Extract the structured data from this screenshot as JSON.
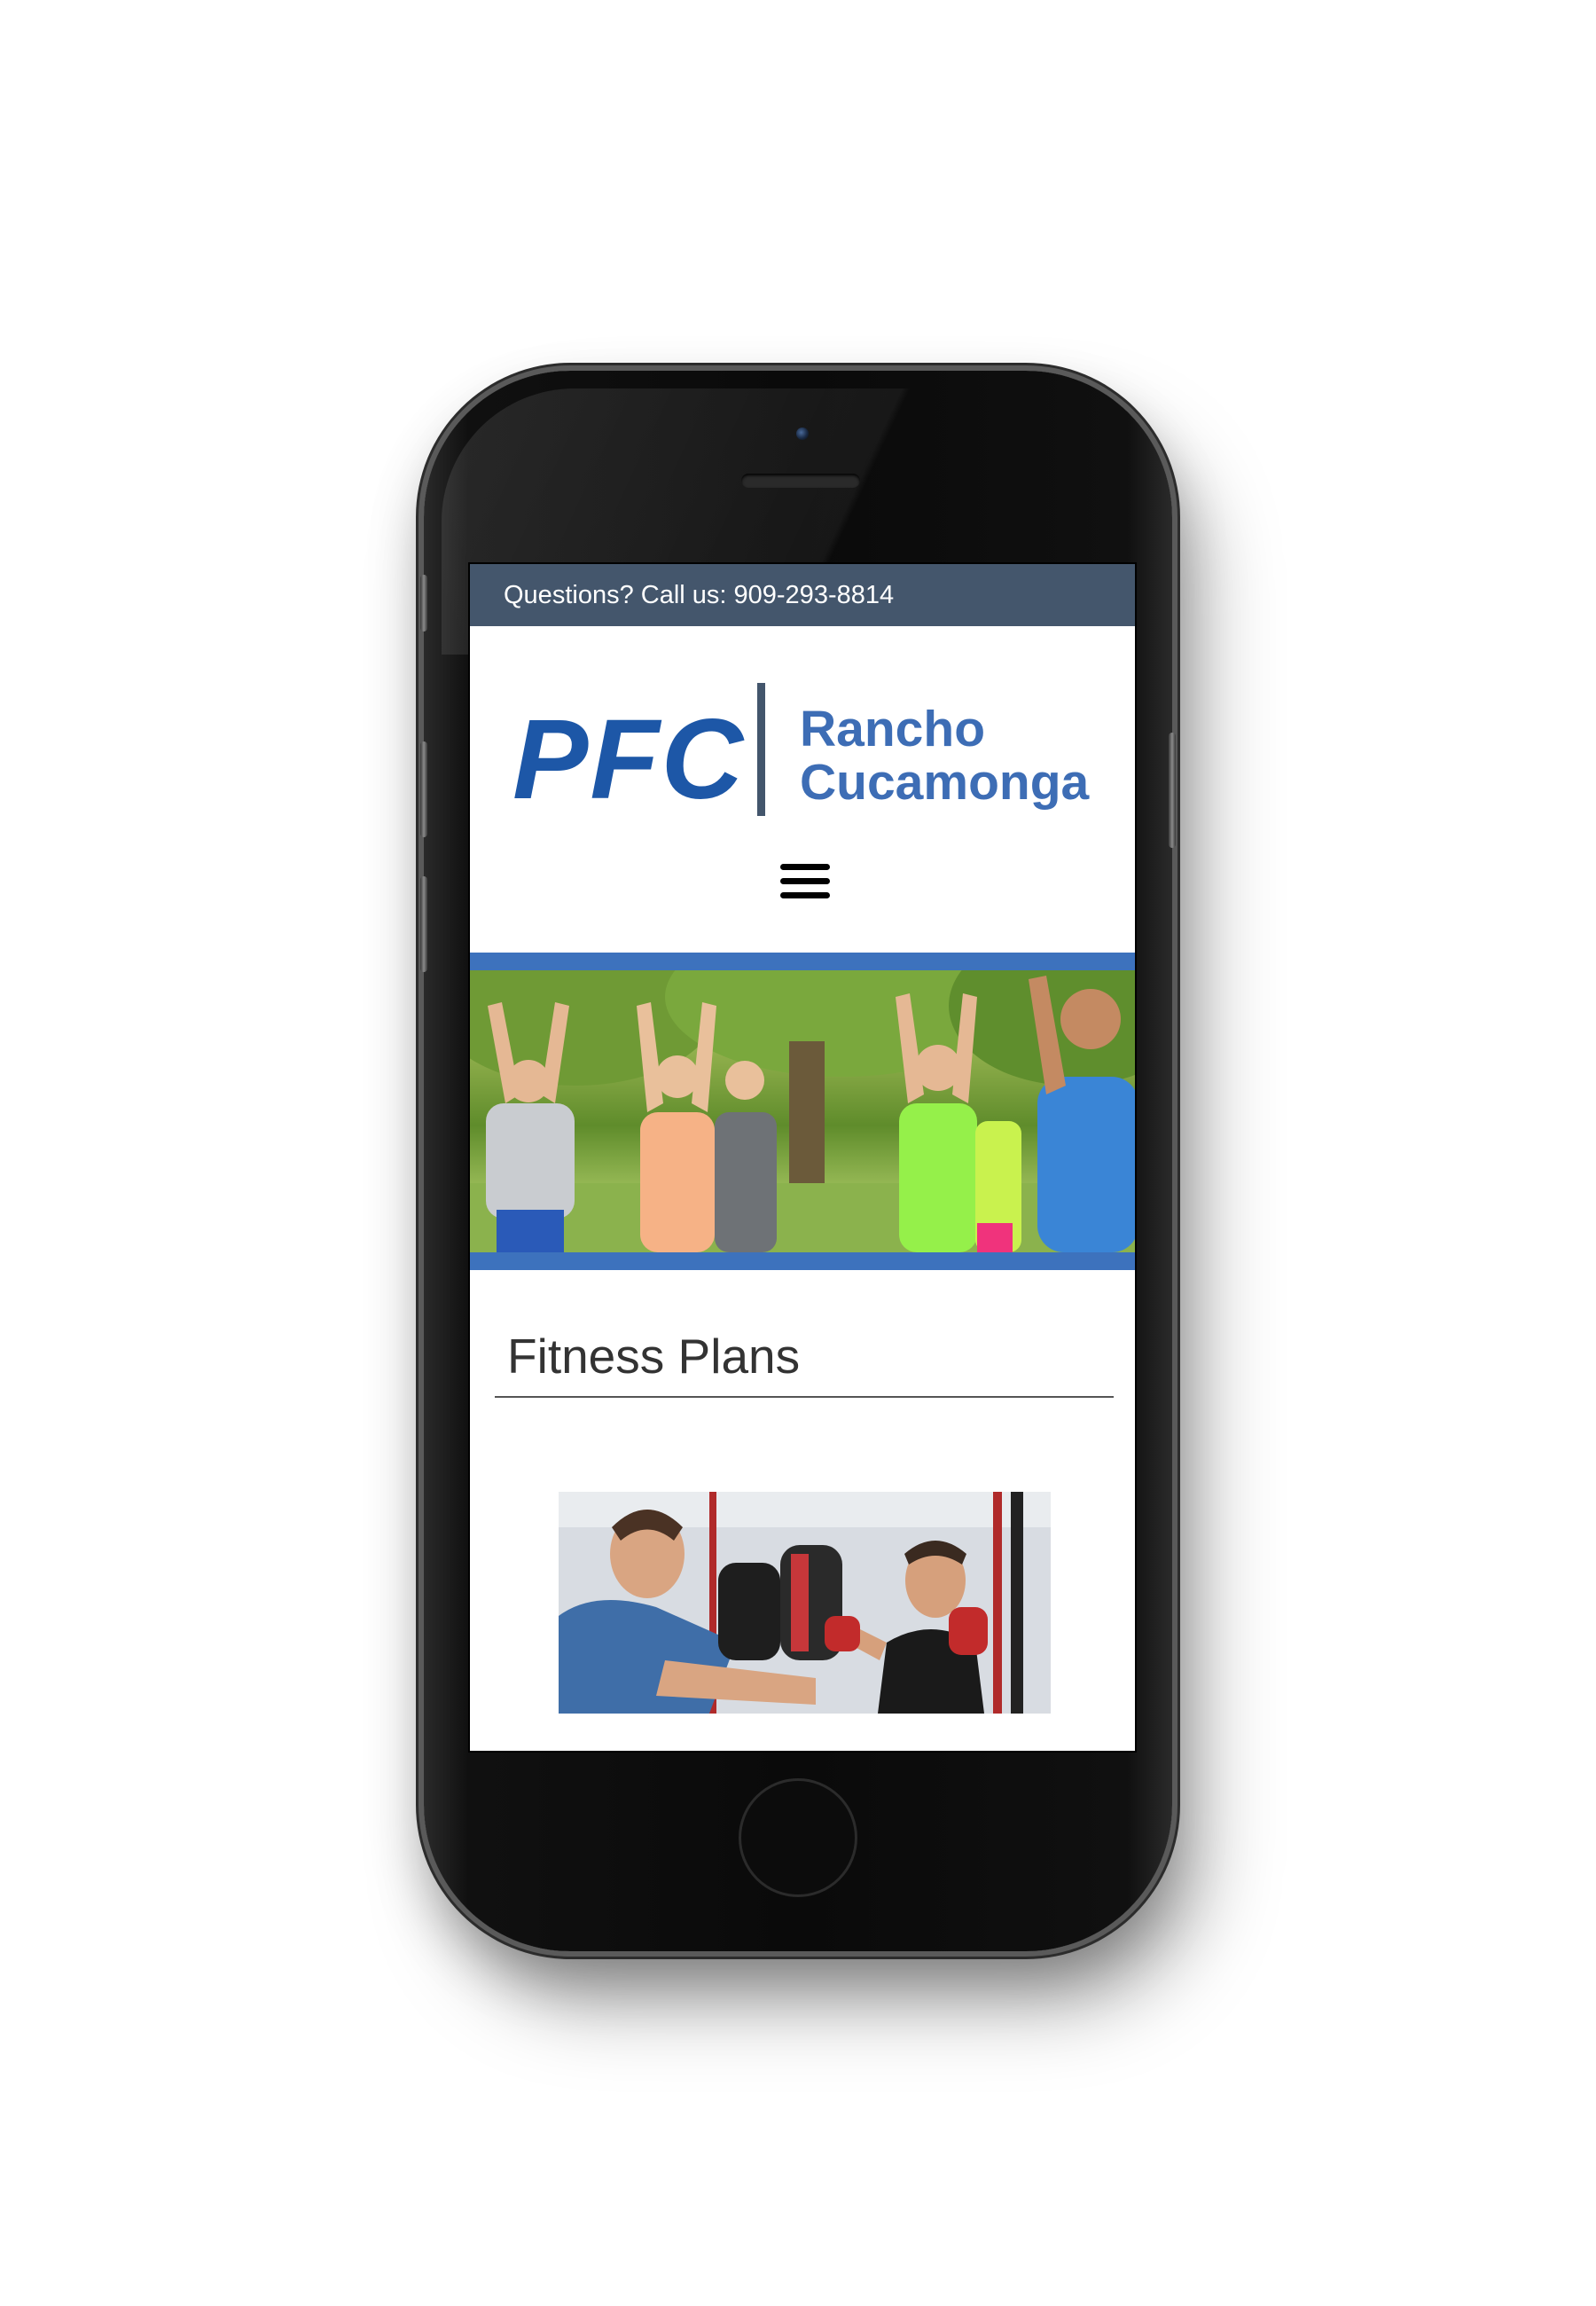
{
  "topbar": {
    "text": "Questions? Call us: 909-293-8814"
  },
  "logo": {
    "brand": "PFC",
    "city_line1": "Rancho",
    "city_line2": "Cucamonga"
  },
  "nav": {
    "menu_icon": "hamburger-menu-icon"
  },
  "hero": {
    "image_alt": "group outdoor stretching class"
  },
  "section": {
    "title": "Fitness Plans"
  },
  "card": {
    "image_alt": "boxing training with punch mitts"
  },
  "colors": {
    "topbar": "#44566c",
    "brand_blue": "#1d57a7",
    "hero_border": "#3d72bd"
  }
}
